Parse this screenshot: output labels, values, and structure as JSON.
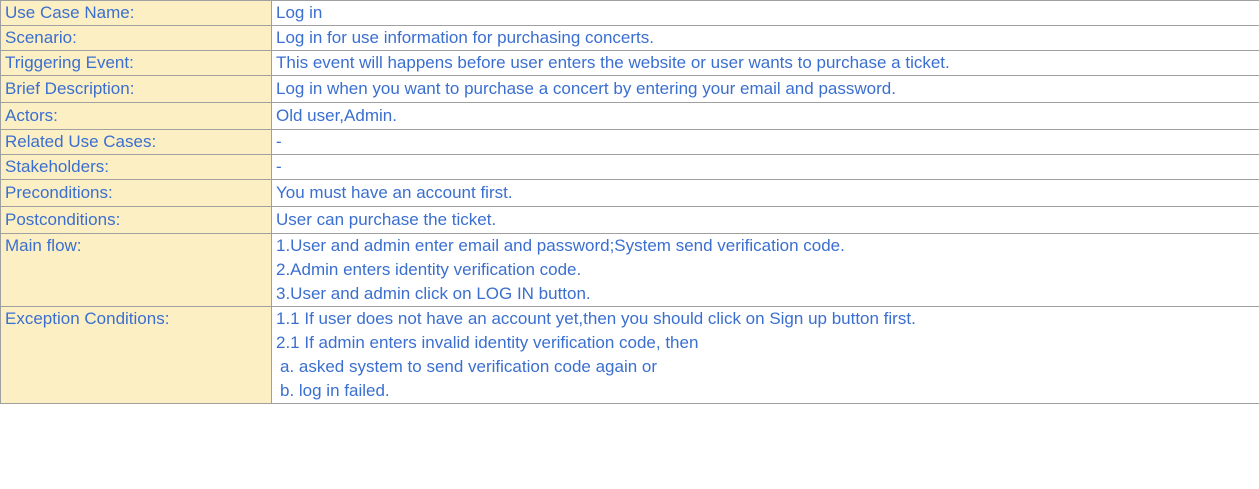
{
  "rows": [
    {
      "label": "Use Case Name:",
      "value": "Log in"
    },
    {
      "label": "Scenario:",
      "value": "Log in for use information for purchasing concerts."
    },
    {
      "label": "Triggering Event:",
      "value": "This event will happens before user enters the website or user wants to purchase a ticket."
    },
    {
      "label": "Brief Description:",
      "value": "Log in when you want to purchase a concert by entering your email and password."
    },
    {
      "label": "Actors:",
      "value": "Old user,Admin."
    },
    {
      "label": "Related Use Cases:",
      "value": "-"
    },
    {
      "label": "Stakeholders:",
      "value": "-"
    },
    {
      "label": "Preconditions:",
      "value": "You must have an account first."
    },
    {
      "label": "Postconditions:",
      "value": "User can purchase the ticket."
    }
  ],
  "main_flow": {
    "label": "Main flow:",
    "lines": [
      "1.User and admin enter email and password;System send verification code.",
      "2.Admin enters identity verification code.",
      "3.User and admin click on LOG IN button."
    ]
  },
  "exceptions": {
    "label": "Exception Conditions:",
    "lines": [
      "1.1 If user does not have an account yet,then you should click on Sign up button first.",
      "2.1 If admin enters invalid identity verification code, then",
      " a. asked system to send verification code again or",
      " b. log in failed."
    ]
  }
}
